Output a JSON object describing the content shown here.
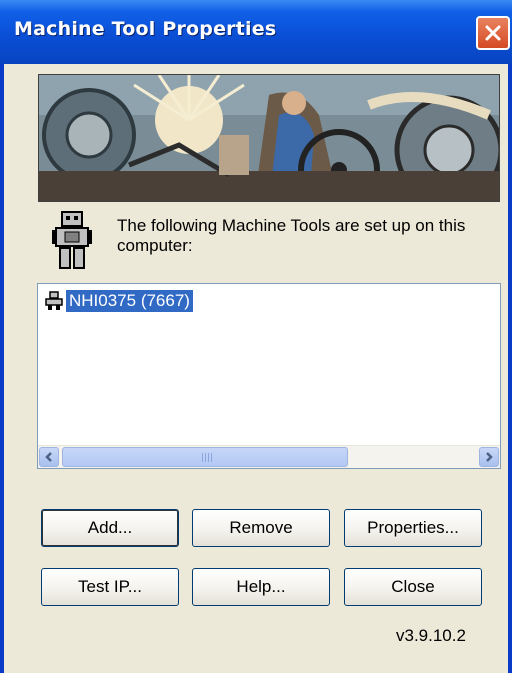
{
  "window": {
    "title": "Machine Tool Properties"
  },
  "info_text": "The following Machine Tools are set up on this computer:",
  "machine_list": {
    "items": [
      {
        "label": "NHI0375 (7667)",
        "selected": true
      }
    ]
  },
  "buttons": {
    "add": "Add...",
    "remove": "Remove",
    "properties": "Properties...",
    "test_ip": "Test IP...",
    "help": "Help...",
    "close": "Close"
  },
  "version": "v3.9.10.2",
  "colors": {
    "titlebar": "#0A4FD6",
    "selection": "#316AC5",
    "dialog_bg": "#ECE9D8",
    "close_button": "#D54A24"
  }
}
